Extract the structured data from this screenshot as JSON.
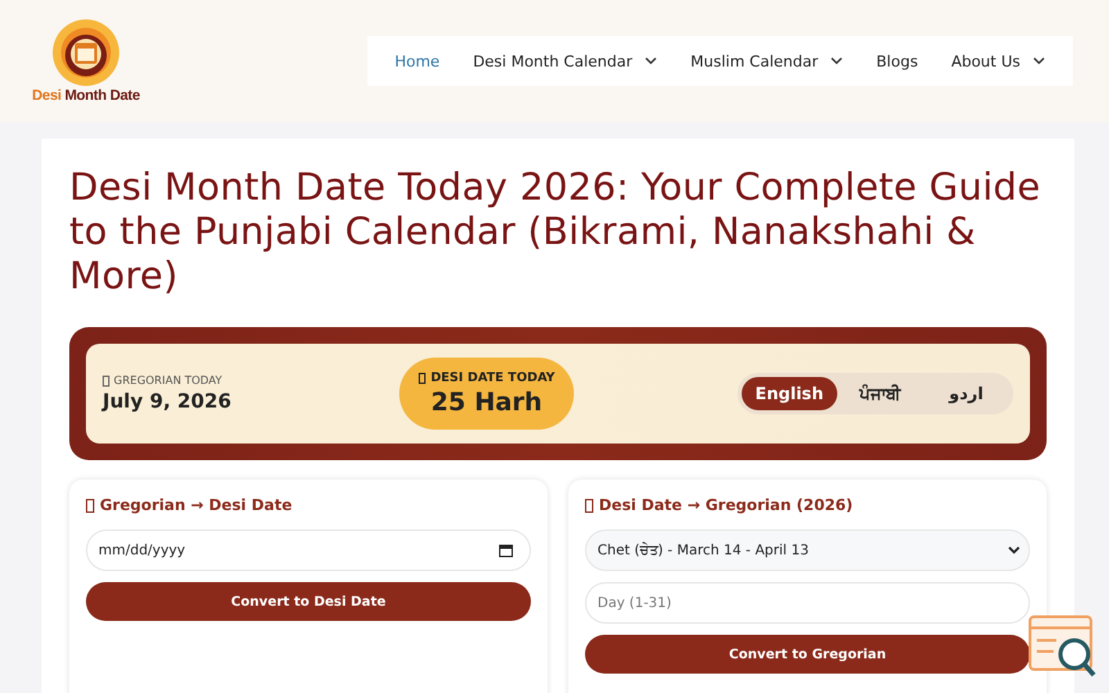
{
  "logo": {
    "text_a": "Desi",
    "text_b": "Month Date"
  },
  "nav": [
    {
      "label": "Home",
      "selected": true,
      "dropdown": false
    },
    {
      "label": "Desi Month Calendar",
      "selected": false,
      "dropdown": true
    },
    {
      "label": "Muslim Calendar",
      "selected": false,
      "dropdown": true
    },
    {
      "label": "Blogs",
      "selected": false,
      "dropdown": false
    },
    {
      "label": "About Us",
      "selected": false,
      "dropdown": true
    }
  ],
  "title": "Desi Month Date Today 2026: Your Complete Guide to the Punjabi Calendar (Bikrami, Nanakshahi & More)",
  "today": {
    "gregorian_label": "GREGORIAN TODAY",
    "gregorian_date": "July 9, 2026",
    "desi_label": "DESI DATE TODAY",
    "desi_date": "25 Harh"
  },
  "languages": [
    {
      "label": "English",
      "selected": true
    },
    {
      "label": "ਪੰਜਾਬੀ",
      "selected": false
    },
    {
      "label": "اردو",
      "selected": false
    }
  ],
  "gregorian_to_desi": {
    "heading": "Gregorian → Desi Date",
    "placeholder": "mm/dd/yyyy",
    "button": "Convert to Desi Date"
  },
  "desi_to_gregorian": {
    "heading": "Desi Date → Gregorian (2026)",
    "month": "Chet (ਚੇਤ) - March 14 - April 13",
    "day_placeholder": "Day (1-31)",
    "button": "Convert to Gregorian"
  }
}
